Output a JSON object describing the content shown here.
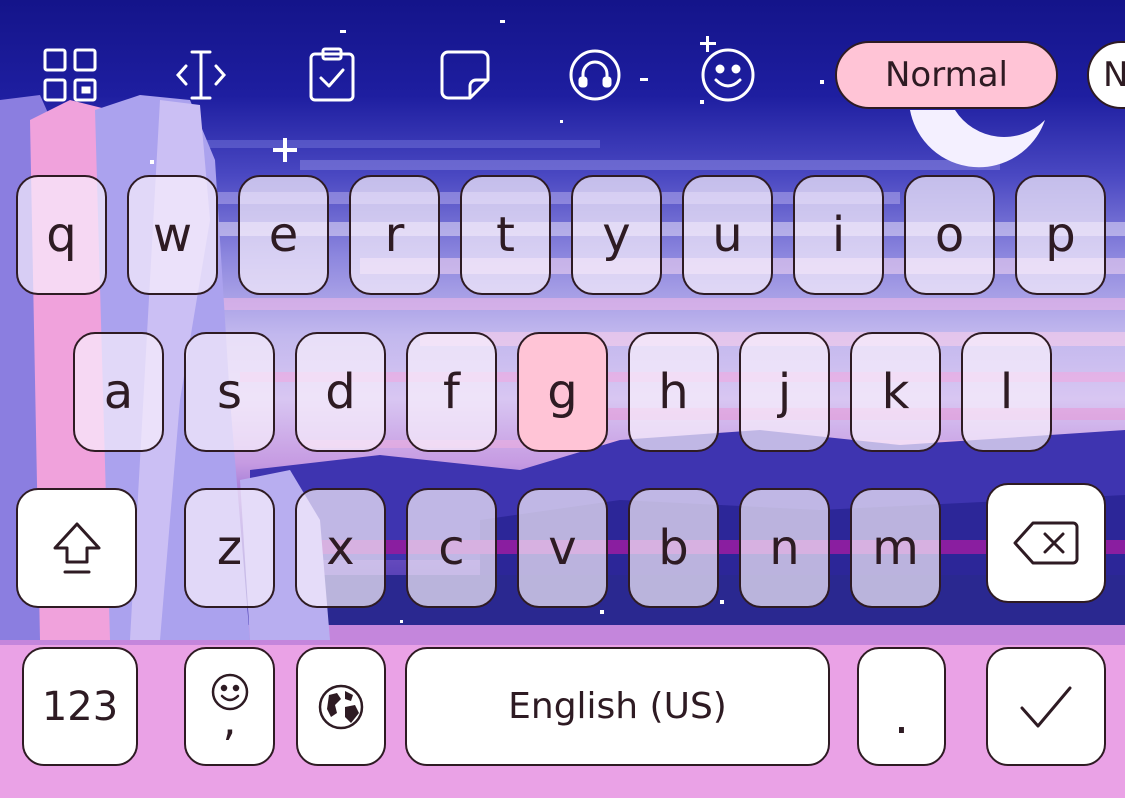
{
  "toolbar": {
    "icons": [
      "grid-icon",
      "text-cursor-icon",
      "clipboard-check-icon",
      "sticker-icon",
      "headset-icon",
      "smiley-icon"
    ],
    "mode_label": "Normal",
    "next_label": "N"
  },
  "keys": {
    "row1": [
      "q",
      "w",
      "e",
      "r",
      "t",
      "y",
      "u",
      "i",
      "o",
      "p"
    ],
    "row2": [
      "a",
      "s",
      "d",
      "f",
      "g",
      "h",
      "j",
      "k",
      "l"
    ],
    "row3": [
      "z",
      "x",
      "c",
      "v",
      "b",
      "n",
      "m"
    ],
    "numbers_label": "123",
    "comma_label": ",",
    "space_label": "English (US)",
    "period_label": "."
  },
  "pressed_key": "g",
  "colors": {
    "sky_top": "#1c1c98",
    "sky_mid": "#4a4ac0",
    "pink": "#f4a2d8",
    "key_fill": "#f6eef8",
    "pressed": "#ffc4d6",
    "outline": "#2e1b23",
    "mode_pill": "#ffc4d6"
  }
}
